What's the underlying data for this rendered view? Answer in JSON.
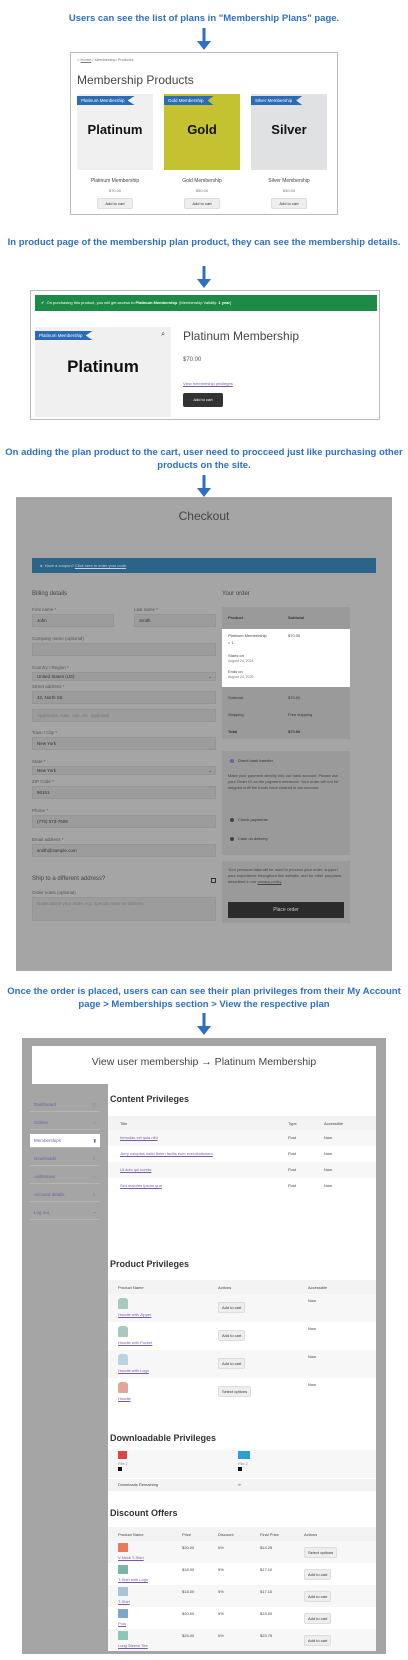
{
  "captions": {
    "c1": "Users can see the list of plans in \"Membership Plans\" page.",
    "c2": "In product page of the membership plan product, they can see the membership details.",
    "c3": "On adding the plan product to the cart, user need to procceed just like purchasing other products on the site.",
    "c4": "Once the order is placed, users can can see their plan privileges from their My Account page > Memberships section > View the respective plan"
  },
  "shop": {
    "breadcrumb_home": "Home",
    "breadcrumb_sep": " / ",
    "breadcrumb_current": "Membership Products",
    "title": "Membership Products",
    "products": [
      {
        "ribbon": "Platinum Membership",
        "image_text": "Platinum",
        "name": "Platinum Membership",
        "price": "$70.00",
        "button": "Add to cart",
        "bg": "#f0f0f0",
        "color": "#111"
      },
      {
        "ribbon": "Gold Membership",
        "image_text": "Gold",
        "name": "Gold Membership",
        "price": "$50.00",
        "button": "Add to cart",
        "bg": "#c4c231",
        "color": "#111"
      },
      {
        "ribbon": "Silver Membership",
        "image_text": "Silver",
        "name": "Silver Membership",
        "price": "$30.00",
        "button": "Add to cart",
        "bg": "#dfe1e3",
        "color": "#111"
      }
    ]
  },
  "product": {
    "notice_prefix": "On purchasing this product, you will get access to ",
    "notice_plan": "Platinum Membership",
    "notice_suffix": ". [Membership Validity: ",
    "notice_validity": "1 year",
    "notice_end": "]",
    "ribbon": "Platinum Membership",
    "image_text": "Platinum",
    "title": "Platinum Membership",
    "price": "$70.00",
    "privileges_link": "View membership privileges",
    "button": "Add to cart"
  },
  "checkout": {
    "title": "Checkout",
    "coupon_prefix": "Have a coupon? ",
    "coupon_link": "Click here to enter your code",
    "billing_title": "Billing details",
    "first_name_label": "First name *",
    "first_name": "John",
    "last_name_label": "Last name *",
    "last_name": "Smith",
    "company_label": "Company name (optional)",
    "country_label": "Country / Region *",
    "country": "United States (US)",
    "street_label": "Street address *",
    "street": "42, North Str.",
    "street2_placeholder": "Apartment, suite, unit, etc. (optional)",
    "city_label": "Town / City *",
    "city": "New York",
    "state_label": "State *",
    "state": "New York",
    "zip_label": "ZIP Code *",
    "zip": "96161",
    "phone_label": "Phone *",
    "phone": "(770) 573-7609",
    "email_label": "Email address *",
    "email": "smith@sample.com",
    "ship_title": "Ship to a different address?",
    "notes_label": "Order notes (optional)",
    "notes_placeholder": "Notes about your order, e.g. special notes for delivery.",
    "order_title": "Your order",
    "col_product": "Product",
    "col_subtotal": "Subtotal",
    "item_name": "Platinum Membership",
    "item_qty": "× 1",
    "item_price": "$70.00",
    "starts_label": "Starts on",
    "starts_date": "August 24, 2024",
    "ends_label": "Ends on",
    "ends_date": "August 24, 2025",
    "subtotal_label": "Subtotal",
    "subtotal": "$70.00",
    "shipping_label": "Shipping",
    "shipping": "Free shipping",
    "total_label": "Total",
    "total": "$70.00",
    "pay_bank": "Direct bank transfer",
    "pay_bank_desc": "Make your payment directly into our bank account. Please use your Order ID as the payment reference. Your order will not be shipped until the funds have cleared in our account.",
    "pay_check": "Check payments",
    "pay_cod": "Cash on delivery",
    "privacy_text": "Your personal data will be used to process your order, support your experience throughout this website, and for other purposes described in our ",
    "privacy_link": "privacy policy",
    "place_order": "Place order"
  },
  "account": {
    "title": "View user membership → Platinum Membership",
    "nav": [
      "Dashboard",
      "Orders",
      "Memberships",
      "Downloads",
      "Addresses",
      "Account details",
      "Log out"
    ],
    "content_title": "Content Privileges",
    "content_cols": [
      "Title",
      "Type",
      "Accessible"
    ],
    "content_rows": [
      {
        "title": "Inmodas vel quia nihi",
        "type": "Post",
        "acc": "Now"
      },
      {
        "title": "Jerry voluptas natio ibrien facilis eum exercitationem",
        "type": "Post",
        "acc": "Now"
      },
      {
        "title": "Ut dolo qui corrds",
        "type": "Post",
        "acc": "Now"
      },
      {
        "title": "Sint maiores ipsum qua",
        "type": "Post",
        "acc": "Now"
      }
    ],
    "product_title": "Product Privileges",
    "product_cols": [
      "Product Name",
      "Actions",
      "Accessible"
    ],
    "product_rows": [
      {
        "name": "Hoodie with Zipper",
        "action": "Add to cart",
        "acc": "Now"
      },
      {
        "name": "Hoodie with Pocket",
        "action": "Add to cart",
        "acc": "Now"
      },
      {
        "name": "Hoodie with Logo",
        "action": "Add to cart",
        "acc": "Now"
      },
      {
        "name": "Hoodie",
        "action": "Select options",
        "acc": "Now"
      }
    ],
    "download_title": "Downloadable Privileges",
    "file1": "File 1",
    "file2": "File 2",
    "downloads_remaining_label": "Downloads Remaining",
    "downloads_remaining": "∞",
    "offer_title": "Discount Offers",
    "offer_cols": [
      "Product Name",
      "Price",
      "Discount",
      "Final Price",
      "Actions"
    ],
    "offer_rows": [
      {
        "name": "V-Neck T-Shirt",
        "price": "$20.00",
        "disc": "5%",
        "final": "$14.25",
        "action": "Select options"
      },
      {
        "name": "T-Shirt with Logo",
        "price": "$18.00",
        "disc": "5%",
        "final": "$17.10",
        "action": "Add to cart"
      },
      {
        "name": "T-Shirt",
        "price": "$18.00",
        "disc": "5%",
        "final": "$17.10",
        "action": "Add to cart"
      },
      {
        "name": "Polo",
        "price": "$20.00",
        "disc": "5%",
        "final": "$19.00",
        "action": "Add to cart"
      },
      {
        "name": "Long Sleeve Tee",
        "price": "$25.00",
        "disc": "5%",
        "final": "$23.75",
        "action": "Add to cart"
      }
    ]
  },
  "colors": {
    "caption": "#2e6fc4",
    "ribbon": "#2c6bb5",
    "notice": "#1e8a47",
    "account_link": "#7a5aa6"
  }
}
